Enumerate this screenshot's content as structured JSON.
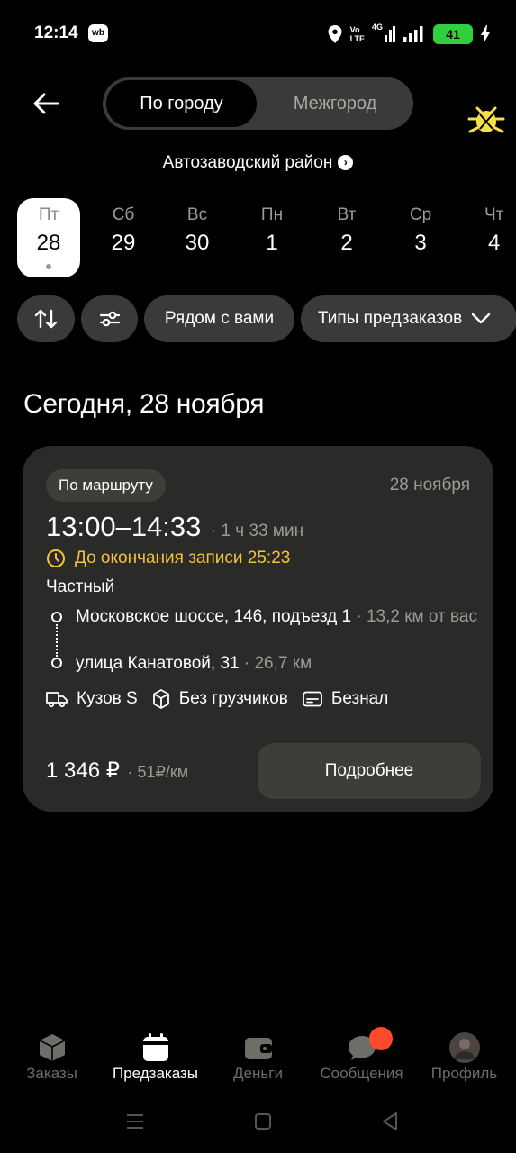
{
  "status_bar": {
    "time": "12:14",
    "wb_badge": "wb",
    "network_top": "Vo",
    "network_bottom": "LTE",
    "network_type": "4G",
    "battery": "41"
  },
  "header": {
    "tabs": [
      {
        "label": "По городу",
        "active": true
      },
      {
        "label": "Межгород",
        "active": false
      }
    ],
    "district": "Автозаводский район"
  },
  "dates": [
    {
      "day": "Пт",
      "num": "28",
      "active": true
    },
    {
      "day": "Сб",
      "num": "29",
      "active": false
    },
    {
      "day": "Вс",
      "num": "30",
      "active": false
    },
    {
      "day": "Пн",
      "num": "1",
      "active": false
    },
    {
      "day": "Вт",
      "num": "2",
      "active": false
    },
    {
      "day": "Ср",
      "num": "3",
      "active": false
    },
    {
      "day": "Чт",
      "num": "4",
      "active": false
    }
  ],
  "filters": {
    "nearby": "Рядом с вами",
    "types": "Типы предзаказов"
  },
  "section_title": "Сегодня, 28 ноября",
  "order": {
    "badge": "По маршруту",
    "date": "28 ноября",
    "time": "13:00–14:33",
    "duration": "· 1 ч 33 мин",
    "deadline": "До окончания записи 25:23",
    "type": "Частный",
    "route": [
      {
        "address": "Московское шоссе, 146, подъезд 1",
        "distance": " · 13,2 км от вас"
      },
      {
        "address": "улица Канатовой, 31",
        "distance": " · 26,7 км"
      }
    ],
    "features": {
      "body": "Кузов S",
      "loaders": "Без грузчиков",
      "payment": "Безнал"
    },
    "price": "1 346 ₽",
    "price_per_km": "· 51₽/км",
    "details_button": "Подробнее"
  },
  "bottom_nav": [
    {
      "label": "Заказы",
      "icon": "box-icon",
      "active": false
    },
    {
      "label": "Предзаказы",
      "icon": "calendar-icon",
      "active": true
    },
    {
      "label": "Деньги",
      "icon": "wallet-icon",
      "active": false
    },
    {
      "label": "Сообщения",
      "icon": "chat-icon",
      "active": false
    },
    {
      "label": "Профиль",
      "icon": "avatar-icon",
      "active": false
    }
  ],
  "colors": {
    "background": "#000000",
    "card": "#2a2a28",
    "chip": "#3a3a38",
    "accent_yellow": "#f6c23c",
    "notification": "#ff4b2c",
    "battery": "#2fd03d"
  }
}
